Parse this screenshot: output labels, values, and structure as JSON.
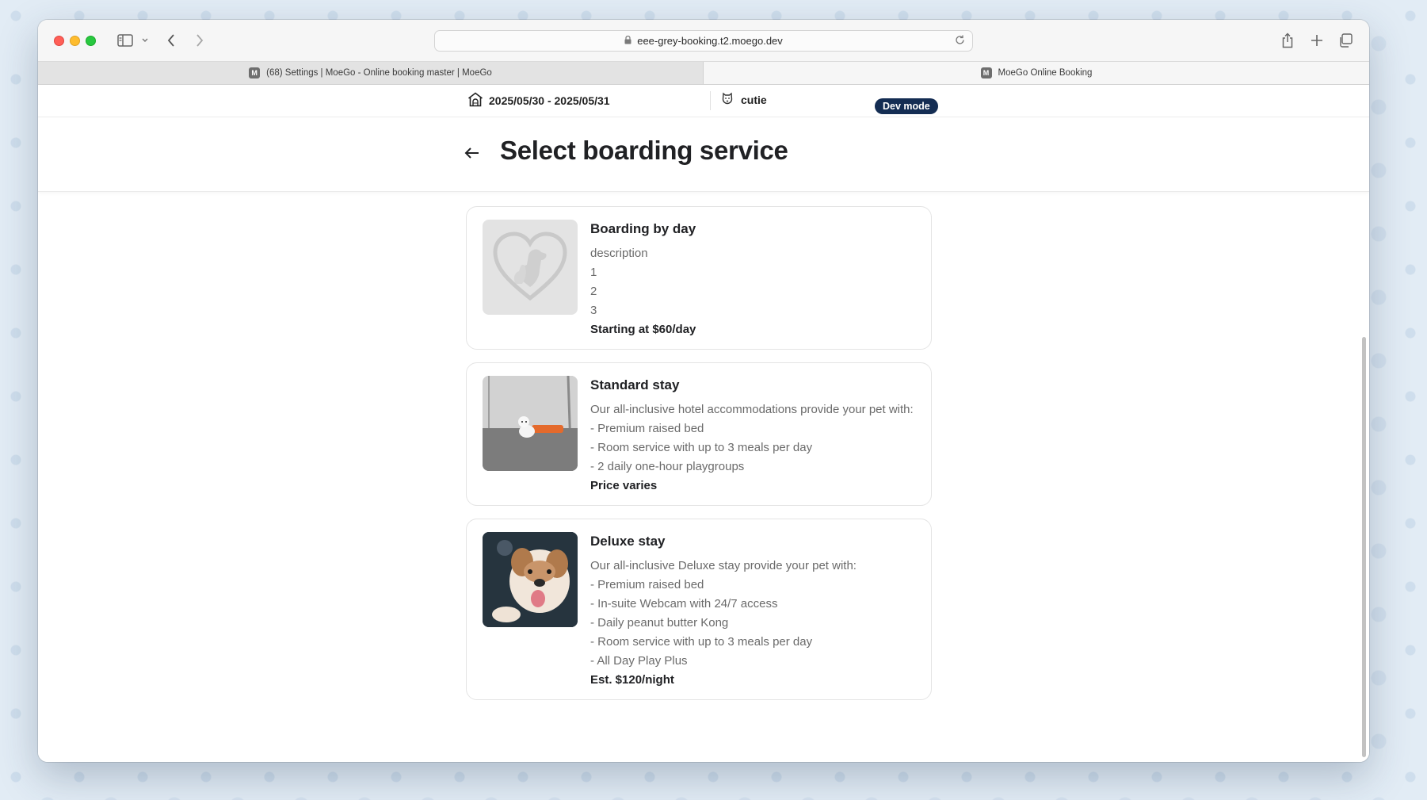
{
  "browser": {
    "address": "eee-grey-booking.t2.moego.dev",
    "tabs": [
      {
        "label": "(68) Settings | MoeGo - Online booking master | MoeGo",
        "favicon": "M"
      },
      {
        "label": "MoeGo Online Booking",
        "favicon": "M"
      }
    ]
  },
  "infobar": {
    "dates": "2025/05/30 - 2025/05/31",
    "pet_name": "cutie",
    "dev_badge": "Dev mode"
  },
  "page": {
    "title": "Select boarding service"
  },
  "services": [
    {
      "name": "Boarding by day",
      "image": "heart-pet-placeholder",
      "lines": [
        "description",
        "1",
        "2",
        "3"
      ],
      "price": "Starting at $60/day"
    },
    {
      "name": "Standard stay",
      "image": "kennel-photo",
      "lines": [
        "Our all-inclusive hotel accommodations provide your pet with:",
        "- Premium raised bed",
        "- Room service with up to 3 meals per day",
        "- 2 daily one-hour playgroups"
      ],
      "price": "Price varies"
    },
    {
      "name": "Deluxe stay",
      "image": "bulldog-photo",
      "lines": [
        "Our all-inclusive Deluxe stay provide your pet with:",
        "- Premium raised bed",
        "- In-suite Webcam with 24/7 access",
        "- Daily peanut butter Kong",
        "- Room service with up to 3 meals per day",
        "- All Day Play Plus"
      ],
      "price": "Est. $120/night"
    }
  ],
  "colors": {
    "dev_badge_bg": "#142d53",
    "title_text": "#202124",
    "muted_text": "#6a6a6a"
  }
}
